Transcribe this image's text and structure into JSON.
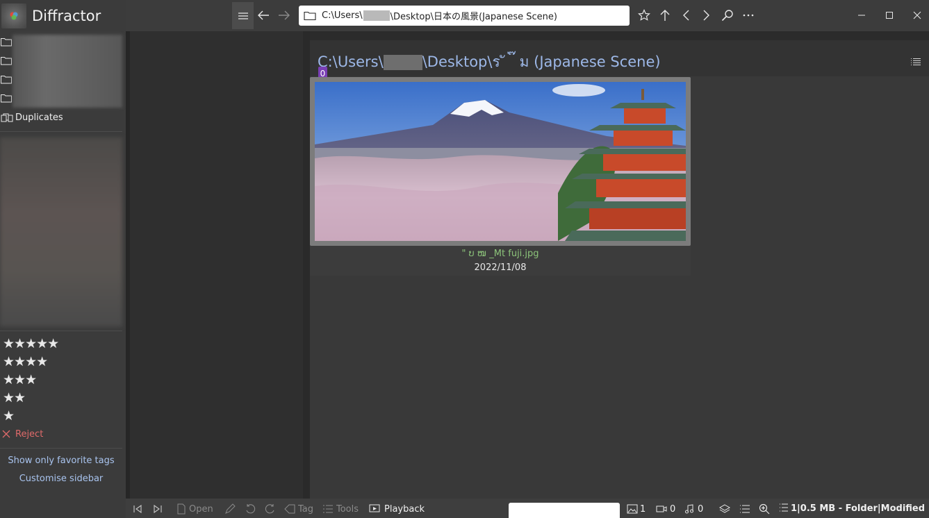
{
  "app": {
    "title": "Diffractor"
  },
  "sidebar": {
    "duplicates_label": "Duplicates",
    "ratings": [
      "★★★★★",
      "★★★★",
      "★★★",
      "★★",
      "★"
    ],
    "reject_label": "Reject",
    "links": [
      "Show only favorite tags",
      "Customise sidebar"
    ]
  },
  "toolbar": {
    "address_prefix": "C:\\Users\\",
    "address_suffix": "\\Desktop\\日本の風景(Japanese Scene)"
  },
  "main": {
    "path_prefix": "C:\\Users\\",
    "path_suffix": "\\Desktop\\ร ั ่ ๊ ม  (Japanese Scene)",
    "count_badge": "0",
    "item": {
      "filename": "\" ບ ໜ  _Mt fuji.jpg",
      "date": "2022/11/08"
    }
  },
  "bottombar": {
    "open_label": "Open",
    "tag_label": "Tag",
    "tools_label": "Tools",
    "playback_label": "Playback",
    "image_count": "1",
    "video_count": "0",
    "audio_count": "0",
    "status": "1|0.5 MB - Folder|Modified"
  },
  "colors": {
    "accent_blue": "#9db8e8",
    "badge_purple": "#7a3fb5",
    "filename_green": "#8cc37a",
    "reject_red": "#e06a6a"
  }
}
